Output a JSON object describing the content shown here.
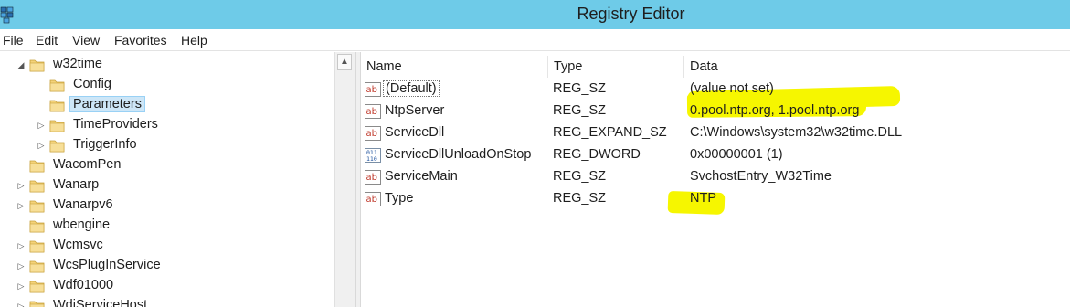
{
  "window": {
    "title": "Registry Editor",
    "icon": "registry-editor-icon"
  },
  "menu": [
    "File",
    "Edit",
    "View",
    "Favorites",
    "Help"
  ],
  "tree": [
    {
      "label": "w32time",
      "expander": "expanded"
    },
    {
      "label": "Config",
      "expander": "none"
    },
    {
      "label": "Parameters",
      "expander": "none",
      "selected": true
    },
    {
      "label": "TimeProviders",
      "expander": "collapsed"
    },
    {
      "label": "TriggerInfo",
      "expander": "collapsed"
    },
    {
      "label": "WacomPen",
      "expander": "none"
    },
    {
      "label": "Wanarp",
      "expander": "collapsed"
    },
    {
      "label": "Wanarpv6",
      "expander": "collapsed"
    },
    {
      "label": "wbengine",
      "expander": "none"
    },
    {
      "label": "Wcmsvc",
      "expander": "collapsed"
    },
    {
      "label": "WcsPlugInService",
      "expander": "collapsed"
    },
    {
      "label": "Wdf01000",
      "expander": "collapsed"
    },
    {
      "label": "WdiServiceHost",
      "expander": "collapsed"
    }
  ],
  "columns": {
    "name": "Name",
    "type": "Type",
    "data": "Data"
  },
  "values": [
    {
      "name": "(Default)",
      "type": "REG_SZ",
      "data": "(value not set)",
      "icon": "string-value-icon"
    },
    {
      "name": "NtpServer",
      "type": "REG_SZ",
      "data": "0.pool.ntp.org, 1.pool.ntp.org",
      "icon": "string-value-icon"
    },
    {
      "name": "ServiceDll",
      "type": "REG_EXPAND_SZ",
      "data": "C:\\Windows\\system32\\w32time.DLL",
      "icon": "string-value-icon"
    },
    {
      "name": "ServiceDllUnloadOnStop",
      "type": "REG_DWORD",
      "data": "0x00000001 (1)",
      "icon": "binary-value-icon"
    },
    {
      "name": "ServiceMain",
      "type": "REG_SZ",
      "data": "SvchostEntry_W32Time",
      "icon": "string-value-icon"
    },
    {
      "name": "Type",
      "type": "REG_SZ",
      "data": "NTP",
      "icon": "string-value-icon"
    }
  ],
  "highlight_color": "#f6f600",
  "titlebar_color": "#6ecbe8"
}
